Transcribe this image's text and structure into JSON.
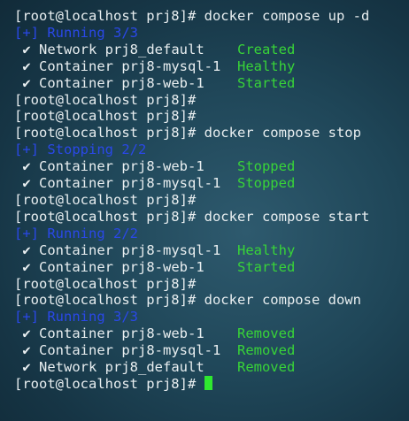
{
  "terminal": {
    "prompt": "[root@localhost prj8]#",
    "lines": [
      {
        "type": "prompt",
        "cmd": " docker compose up -d"
      },
      {
        "type": "header",
        "text": "[+] Running 3/3"
      },
      {
        "type": "status",
        "check": "✔",
        "label": " Network prj8_default    ",
        "state": "Created"
      },
      {
        "type": "status",
        "check": "✔",
        "label": " Container prj8-mysql-1  ",
        "state": "Healthy"
      },
      {
        "type": "status",
        "check": "✔",
        "label": " Container prj8-web-1    ",
        "state": "Started"
      },
      {
        "type": "prompt",
        "cmd": ""
      },
      {
        "type": "prompt",
        "cmd": ""
      },
      {
        "type": "prompt",
        "cmd": " docker compose stop"
      },
      {
        "type": "header",
        "text": "[+] Stopping 2/2"
      },
      {
        "type": "status",
        "check": "✔",
        "label": " Container prj8-web-1    ",
        "state": "Stopped"
      },
      {
        "type": "status",
        "check": "✔",
        "label": " Container prj8-mysql-1  ",
        "state": "Stopped"
      },
      {
        "type": "prompt",
        "cmd": ""
      },
      {
        "type": "prompt",
        "cmd": " docker compose start"
      },
      {
        "type": "header",
        "text": "[+] Running 2/2"
      },
      {
        "type": "status",
        "check": "✔",
        "label": " Container prj8-mysql-1  ",
        "state": "Healthy"
      },
      {
        "type": "status",
        "check": "✔",
        "label": " Container prj8-web-1    ",
        "state": "Started"
      },
      {
        "type": "prompt",
        "cmd": ""
      },
      {
        "type": "prompt",
        "cmd": " docker compose down"
      },
      {
        "type": "header",
        "text": "[+] Running 3/3"
      },
      {
        "type": "status",
        "check": "✔",
        "label": " Container prj8-web-1    ",
        "state": "Removed"
      },
      {
        "type": "status",
        "check": "✔",
        "label": " Container prj8-mysql-1  ",
        "state": "Removed"
      },
      {
        "type": "status",
        "check": "✔",
        "label": " Network prj8_default    ",
        "state": "Removed"
      },
      {
        "type": "prompt",
        "cmd": " ",
        "cursor": true
      }
    ]
  },
  "colors": {
    "header": "#2a48e8",
    "state": "#38d438",
    "cursor": "#2fe82f",
    "text": "#e8eef0"
  }
}
